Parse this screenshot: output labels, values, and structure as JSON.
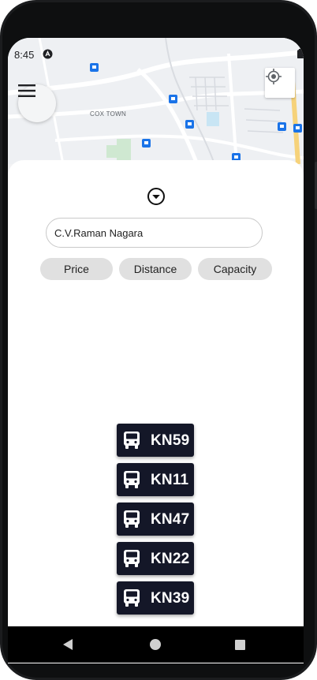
{
  "status_bar": {
    "time": "8:45"
  },
  "map": {
    "label_area": "COX TOWN"
  },
  "search": {
    "value": "C.V.Raman Nagara"
  },
  "filters": [
    "Price",
    "Distance",
    "Capacity"
  ],
  "buses": [
    "KN59",
    "KN11",
    "KN47",
    "KN22",
    "KN39"
  ],
  "colors": {
    "bus_bg": "#141728",
    "chip_bg": "#e0e0e0",
    "accent_transit": "#1a73e8"
  }
}
